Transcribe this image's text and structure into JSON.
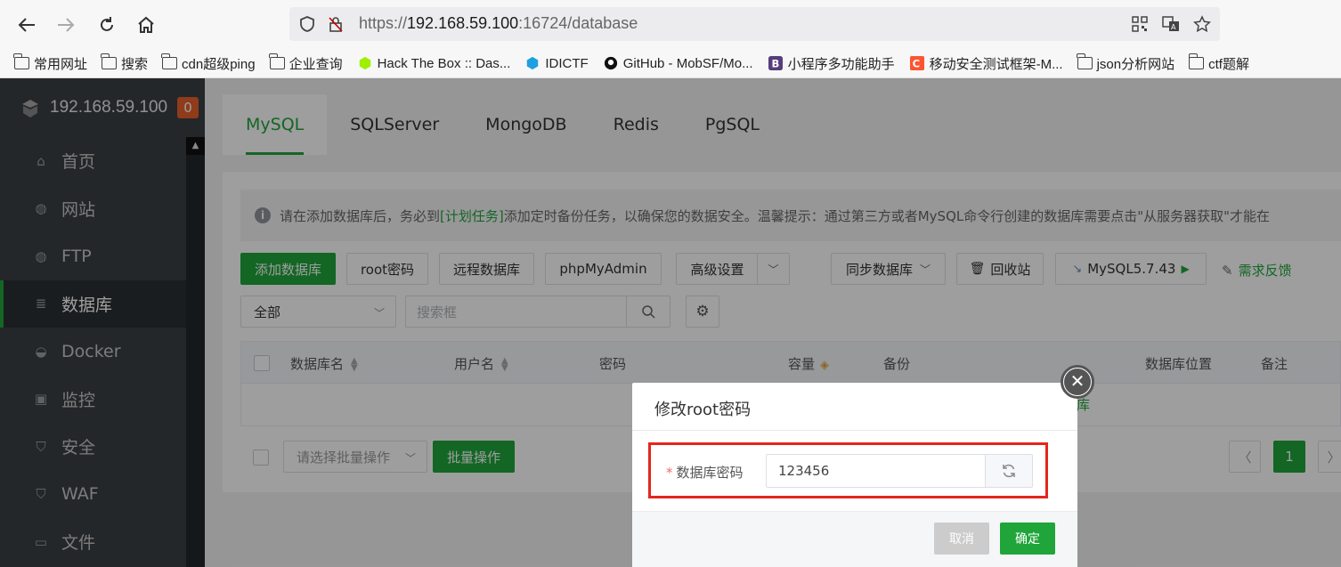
{
  "browser": {
    "url_prefix": "https://",
    "url_host": "192.168.59.100",
    "url_rest": ":16724/database",
    "bookmarks": [
      {
        "label": "常用网址",
        "icon": "folder-icon"
      },
      {
        "label": "搜索",
        "icon": "folder-icon"
      },
      {
        "label": "cdn超级ping",
        "icon": "folder-icon"
      },
      {
        "label": "企业查询",
        "icon": "folder-icon"
      },
      {
        "label": "Hack The Box :: Das...",
        "icon": "hackthebox-icon"
      },
      {
        "label": "IDICTF",
        "icon": "idictf-icon"
      },
      {
        "label": "GitHub - MobSF/Mo...",
        "icon": "github-icon"
      },
      {
        "label": "小程序多功能助手",
        "icon": "bootstrap-icon"
      },
      {
        "label": "移动安全测试框架-M...",
        "icon": "csdn-icon"
      },
      {
        "label": "json分析网站",
        "icon": "folder-icon"
      },
      {
        "label": "ctf题解",
        "icon": "folder-icon"
      }
    ]
  },
  "sidebar": {
    "ip": "192.168.59.100",
    "badge": "0",
    "items": [
      {
        "label": "首页",
        "icon": "home-icon"
      },
      {
        "label": "网站",
        "icon": "globe-icon"
      },
      {
        "label": "FTP",
        "icon": "ftp-icon"
      },
      {
        "label": "数据库",
        "icon": "database-icon"
      },
      {
        "label": "Docker",
        "icon": "docker-icon"
      },
      {
        "label": "监控",
        "icon": "monitor-icon"
      },
      {
        "label": "安全",
        "icon": "shield-icon"
      },
      {
        "label": "WAF",
        "icon": "waf-icon"
      },
      {
        "label": "文件",
        "icon": "folder-icon"
      }
    ]
  },
  "tabs": [
    "MySQL",
    "SQLServer",
    "MongoDB",
    "Redis",
    "PgSQL"
  ],
  "alert": {
    "before": "请在添加数据库后，务必到",
    "link": "[计划任务]",
    "after": "添加定时备份任务，以确保您的数据安全。温馨提示：通过第三方或者MySQL命令行创建的数据库需要点击\"从服务器获取\"才能在"
  },
  "toolbar": {
    "add_db": "添加数据库",
    "root_pw": "root密码",
    "remote_db": "远程数据库",
    "phpmyadmin": "phpMyAdmin",
    "advanced": "高级设置",
    "sync_db": "同步数据库",
    "recycle": "回收站",
    "mysql_version": "MySQL5.7.43",
    "feedback": "需求反馈",
    "filter_all": "全部",
    "search_placeholder": "搜索框"
  },
  "table": {
    "headers": [
      "数据库名",
      "用户名",
      "密码",
      "容量",
      "备份",
      "数据库位置",
      "备注"
    ],
    "empty_fragment": "库"
  },
  "footer": {
    "batch_placeholder": "请选择批量操作",
    "batch_button": "批量操作",
    "page": "1"
  },
  "modal": {
    "title": "修改root密码",
    "required_mark": "*",
    "field_label": "数据库密码",
    "password_value": "123456",
    "cancel": "取消",
    "confirm": "确定"
  },
  "colors": {
    "accent": "#20a53a",
    "sidebar_bg": "#3a3f44",
    "highlight": "#e4261d",
    "badge": "#e5622b"
  }
}
